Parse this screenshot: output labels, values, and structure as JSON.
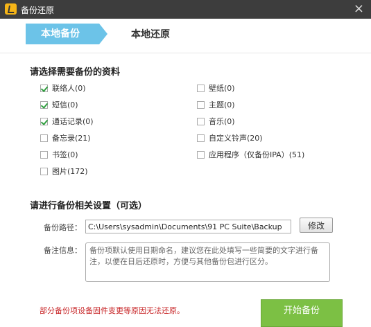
{
  "window": {
    "title": "备份还原",
    "icon": "app-logo-icon",
    "close_glyph": "×"
  },
  "tabs": [
    {
      "label": "本地备份",
      "active": true
    },
    {
      "label": "本地还原",
      "active": false
    }
  ],
  "data_section": {
    "title": "请选择需要备份的资料",
    "left_items": [
      {
        "label": "联络人(0)",
        "checked": true
      },
      {
        "label": "短信(0)",
        "checked": true
      },
      {
        "label": "通话记录(0)",
        "checked": true
      },
      {
        "label": "备忘录(21)",
        "checked": false
      },
      {
        "label": "书签(0)",
        "checked": false
      },
      {
        "label": "图片(172)",
        "checked": false
      }
    ],
    "right_items": [
      {
        "label": "壁纸(0)",
        "checked": false
      },
      {
        "label": "主题(0)",
        "checked": false
      },
      {
        "label": "音乐(0)",
        "checked": false
      },
      {
        "label": "自定义铃声(20)",
        "checked": false
      },
      {
        "label": "应用程序（仅备份IPA）(51)",
        "checked": false
      }
    ]
  },
  "settings_section": {
    "title": "请进行备份相关设置（可选）",
    "path_label": "备份路径：",
    "path_value": "C:\\Users\\sysadmin\\Documents\\91 PC Suite\\Backup",
    "edit_button": "修改",
    "note_label": "备注信息：",
    "note_placeholder": "备份项默认使用日期命名，建议您在此处填写一些简要的文字进行备注，以便在日后还原时，方便与其他备份包进行区分。"
  },
  "footer": {
    "warning": "部分备份项设备固件变更等原因无法还原。",
    "start_button": "开始备份"
  },
  "colors": {
    "accent": "#6cc3e8",
    "start": "#7cc044",
    "warning": "#c8282a",
    "titlebar": "#3d3d3d"
  }
}
